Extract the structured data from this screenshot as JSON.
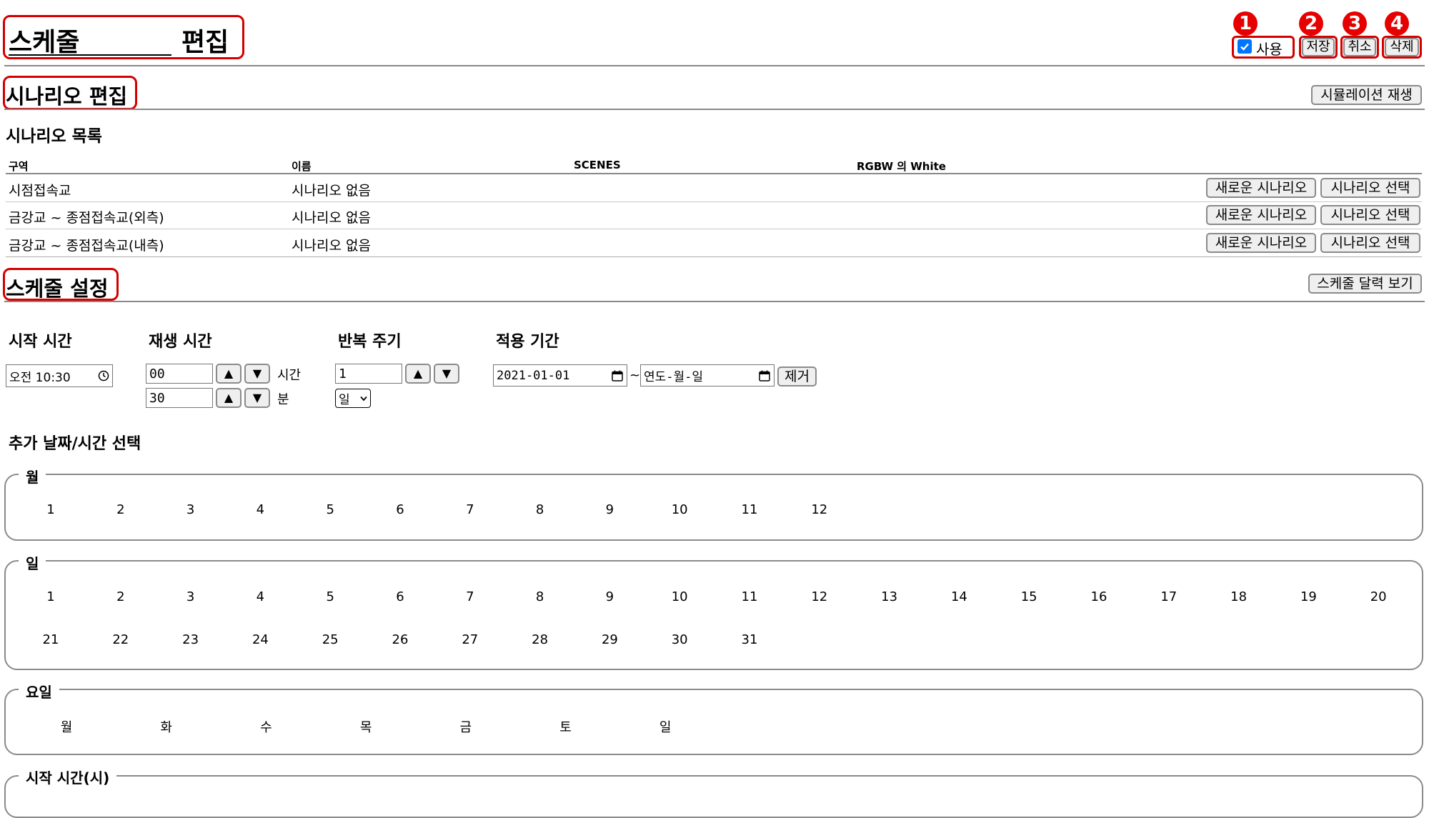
{
  "header": {
    "title_left": "스케줄",
    "title_right": "편집",
    "use_label": "사용",
    "use_checked": true,
    "save_label": "저장",
    "cancel_label": "취소",
    "delete_label": "삭제",
    "badges": [
      "1",
      "2",
      "3",
      "4"
    ]
  },
  "scenario": {
    "title": "시나리오 편집",
    "simulation_button": "시뮬레이션 재생",
    "list_title": "시나리오 목록",
    "columns": [
      "구역",
      "이름",
      "SCENES",
      "RGBW 의 White"
    ],
    "rows": [
      {
        "area": "시점접속교",
        "name": "시나리오 없음",
        "new_button": "새로운 시나리오",
        "select_button": "시나리오 선택"
      },
      {
        "area": "금강교 ~ 종점접속교(외측)",
        "name": "시나리오 없음",
        "new_button": "새로운 시나리오",
        "select_button": "시나리오 선택"
      },
      {
        "area": "금강교 ~ 종점접속교(내측)",
        "name": "시나리오 없음",
        "new_button": "새로운 시나리오",
        "select_button": "시나리오 선택"
      }
    ]
  },
  "schedule": {
    "title": "스케줄 설정",
    "calendar_button": "스케줄 달력 보기",
    "start_time_label": "시작 시간",
    "start_time_value": "오전 10:30",
    "play_time_label": "재생 시간",
    "hours_value": "00",
    "hours_unit": "시간",
    "minutes_value": "30",
    "minutes_unit": "분",
    "repeat_label": "반복 주기",
    "repeat_value": "1",
    "repeat_unit": "일",
    "period_label": "적용 기간",
    "period_start": "2021-01-01",
    "period_sep": "~",
    "period_end_placeholder": "연도-월-일",
    "remove_button": "제거",
    "up_arrow": "▲",
    "down_arrow": "▼"
  },
  "extra": {
    "title": "추가 날짜/시간 선택",
    "month_legend": "월",
    "months": [
      "1",
      "2",
      "3",
      "4",
      "5",
      "6",
      "7",
      "8",
      "9",
      "10",
      "11",
      "12"
    ],
    "day_legend": "일",
    "days": [
      "1",
      "2",
      "3",
      "4",
      "5",
      "6",
      "7",
      "8",
      "9",
      "10",
      "11",
      "12",
      "13",
      "14",
      "15",
      "16",
      "17",
      "18",
      "19",
      "20",
      "21",
      "22",
      "23",
      "24",
      "25",
      "26",
      "27",
      "28",
      "29",
      "30",
      "31"
    ],
    "weekday_legend": "요일",
    "weekdays": [
      "월",
      "화",
      "수",
      "목",
      "금",
      "토",
      "일"
    ],
    "start_hour_legend": "시작 시간(시)"
  },
  "icons": {
    "calendar": "calendar-icon",
    "clock": "clock-icon",
    "dropdown": "chevron-down-icon"
  },
  "colors": {
    "accent_red": "#d40000",
    "badge_red": "#e60000",
    "checkbox_blue": "#0075ff"
  }
}
